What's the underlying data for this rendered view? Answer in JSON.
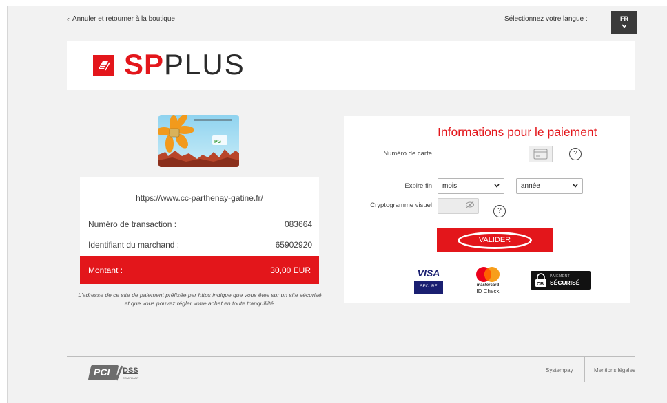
{
  "header": {
    "back_label": "Annuler et retourner à la boutique",
    "language_label": "Sélectionnez votre langue :",
    "language_value": "FR"
  },
  "brand": {
    "name_bold": "SP",
    "name_light": "PLUS",
    "color": "#e3161b"
  },
  "summary": {
    "site_url": "https://www.cc-parthenay-gatine.fr/",
    "rows": [
      {
        "label": "Numéro de transaction :",
        "value": "083664"
      },
      {
        "label": "Identifiant du marchand :",
        "value": "65902920"
      }
    ],
    "amount_label": "Montant :",
    "amount_value": "30,00 EUR",
    "note": "L'adresse de ce site de paiement préfixée par https indique que vous êtes sur un site sécurisé et que vous pouvez régler votre achat en toute tranquillité."
  },
  "payment": {
    "title": "Informations pour le paiement",
    "card_number_label": "Numéro de carte",
    "card_number_value": "",
    "help_symbol": "?",
    "expiry_label": "Expire fin",
    "month_value": "mois",
    "year_value": "année",
    "cvv_label": "Cryptogramme visuel",
    "cvv_value": "",
    "validate_label": "VALIDER"
  },
  "badges": {
    "visa_title": "VISA",
    "visa_sub": "SECURE",
    "mastercard_line1": "mastercard",
    "mastercard_line2": "ID Check",
    "secure_line1": "PAIEMENT",
    "secure_line2": "SÉCURISÉ"
  },
  "footer": {
    "pci_text": "PCI",
    "dss_text": "DSS",
    "compliant_text": "COMPLIANT",
    "provider": "Systempay",
    "legal_link": "Mentions légales"
  },
  "icons": {
    "back": "chevron-left-icon",
    "language_toggle": "chevron-down-icon",
    "card_type": "credit-card-icon",
    "help": "question-circle-icon",
    "cvv_visibility": "eye-slash-icon"
  }
}
